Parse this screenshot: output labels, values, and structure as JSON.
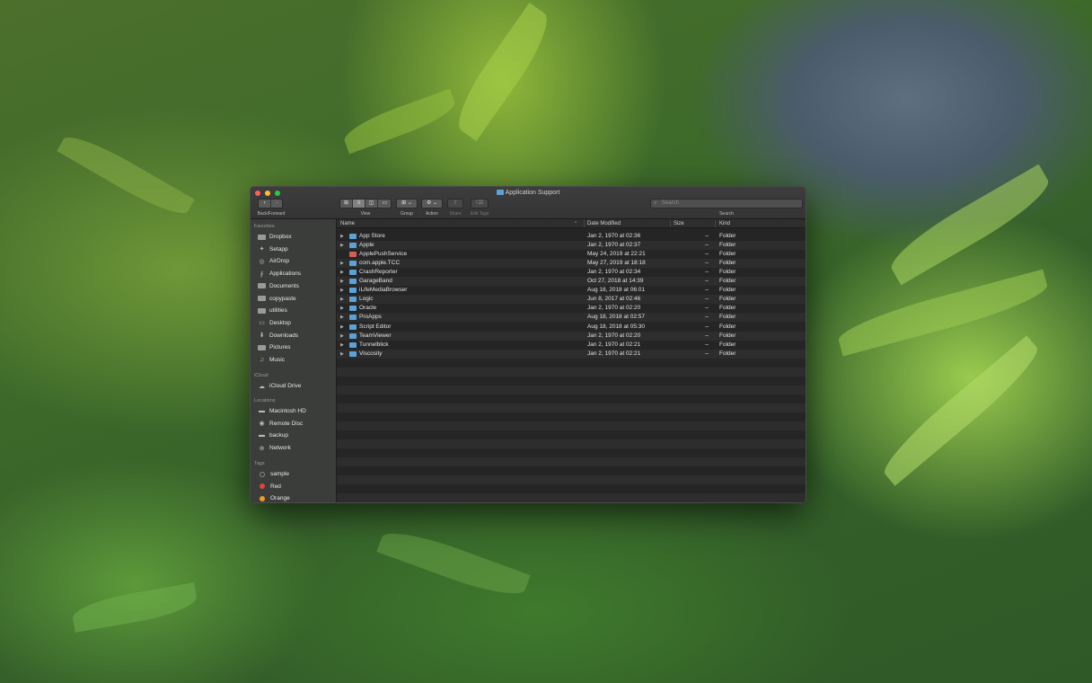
{
  "window": {
    "title": "Application Support",
    "toolbar": {
      "back_forward_label": "Back/Forward",
      "view_label": "View",
      "group_label": "Group",
      "action_label": "Action",
      "share_label": "Share",
      "edit_tags_label": "Edit Tags",
      "search_placeholder": "Search",
      "search_label": "Search"
    }
  },
  "sidebar": {
    "favorites_header": "Favorites",
    "favorites": [
      {
        "label": "Dropbox",
        "icon": "dropbox-icon"
      },
      {
        "label": "Setapp",
        "icon": "setapp-icon"
      },
      {
        "label": "AirDrop",
        "icon": "airdrop-icon"
      },
      {
        "label": "Applications",
        "icon": "applications-icon"
      },
      {
        "label": "Documents",
        "icon": "folder-icon"
      },
      {
        "label": "copypaste",
        "icon": "folder-icon"
      },
      {
        "label": "utilities",
        "icon": "folder-icon"
      },
      {
        "label": "Desktop",
        "icon": "desktop-icon"
      },
      {
        "label": "Downloads",
        "icon": "downloads-icon"
      },
      {
        "label": "Pictures",
        "icon": "folder-icon"
      },
      {
        "label": "Music",
        "icon": "music-icon"
      }
    ],
    "icloud_header": "iCloud",
    "icloud": [
      {
        "label": "iCloud Drive",
        "icon": "cloud-icon"
      }
    ],
    "locations_header": "Locations",
    "locations": [
      {
        "label": "Macintosh HD",
        "icon": "disk-icon"
      },
      {
        "label": "Remote Disc",
        "icon": "disc-icon"
      },
      {
        "label": "backup",
        "icon": "disk-icon"
      },
      {
        "label": "Network",
        "icon": "network-icon"
      }
    ],
    "tags_header": "Tags",
    "tags": [
      {
        "label": "sample",
        "color": "#3a3d3a"
      },
      {
        "label": "Red",
        "color": "#e0443e"
      },
      {
        "label": "Orange",
        "color": "#f39a26"
      }
    ]
  },
  "columns": {
    "name": "Name",
    "date_modified": "Date Modified",
    "size": "Size",
    "kind": "Kind"
  },
  "files": [
    {
      "name": "App Store",
      "date": "Jan 2, 1970 at 02:36",
      "size": "--",
      "kind": "Folder",
      "expandable": true
    },
    {
      "name": "Apple",
      "date": "Jan 2, 1970 at 02:37",
      "size": "--",
      "kind": "Folder",
      "expandable": true
    },
    {
      "name": "ApplePushService",
      "date": "May 24, 2019 at 22:21",
      "size": "--",
      "kind": "Folder",
      "expandable": false
    },
    {
      "name": "com.apple.TCC",
      "date": "May 27, 2019 at 18:18",
      "size": "--",
      "kind": "Folder",
      "expandable": true
    },
    {
      "name": "CrashReporter",
      "date": "Jan 2, 1970 at 02:34",
      "size": "--",
      "kind": "Folder",
      "expandable": true
    },
    {
      "name": "GarageBand",
      "date": "Oct 27, 2018 at 14:39",
      "size": "--",
      "kind": "Folder",
      "expandable": true
    },
    {
      "name": "iLifeMediaBrowser",
      "date": "Aug 18, 2018 at 06:01",
      "size": "--",
      "kind": "Folder",
      "expandable": true
    },
    {
      "name": "Logic",
      "date": "Jun 8, 2017 at 02:46",
      "size": "--",
      "kind": "Folder",
      "expandable": true
    },
    {
      "name": "Oracle",
      "date": "Jan 2, 1970 at 02:20",
      "size": "--",
      "kind": "Folder",
      "expandable": true
    },
    {
      "name": "ProApps",
      "date": "Aug 18, 2018 at 02:57",
      "size": "--",
      "kind": "Folder",
      "expandable": true
    },
    {
      "name": "Script Editor",
      "date": "Aug 18, 2018 at 05:30",
      "size": "--",
      "kind": "Folder",
      "expandable": true
    },
    {
      "name": "TeamViewer",
      "date": "Jan 2, 1970 at 02:20",
      "size": "--",
      "kind": "Folder",
      "expandable": true
    },
    {
      "name": "Tunnelblick",
      "date": "Jan 2, 1970 at 02:21",
      "size": "--",
      "kind": "Folder",
      "expandable": true
    },
    {
      "name": "Viscosity",
      "date": "Jan 2, 1970 at 02:21",
      "size": "--",
      "kind": "Folder",
      "expandable": true
    }
  ]
}
